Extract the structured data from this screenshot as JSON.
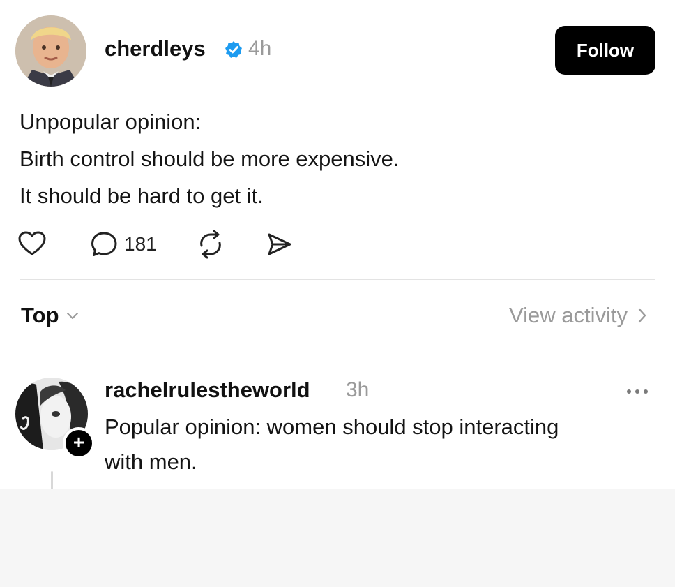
{
  "post": {
    "username": "cherdleys",
    "verified": true,
    "timestamp": "4h",
    "follow_label": "Follow",
    "lines": [
      "Unpopular opinion:",
      "Birth control should be more expensive.",
      "It should be hard to get it."
    ],
    "actions": {
      "like_icon": "heart-icon",
      "reply_icon": "comment-icon",
      "reply_count": "181",
      "repost_icon": "repost-icon",
      "share_icon": "send-icon"
    }
  },
  "sort": {
    "label": "Top",
    "view_activity": "View activity"
  },
  "reply": {
    "username": "rachelrulestheworld",
    "timestamp": "3h",
    "lines": [
      "Popular opinion: women should stop interacting",
      "with men."
    ],
    "add_badge": "+"
  },
  "colors": {
    "verified_blue": "#1d9bf0",
    "muted_gray": "#9a9a9a",
    "button_black": "#000000"
  }
}
